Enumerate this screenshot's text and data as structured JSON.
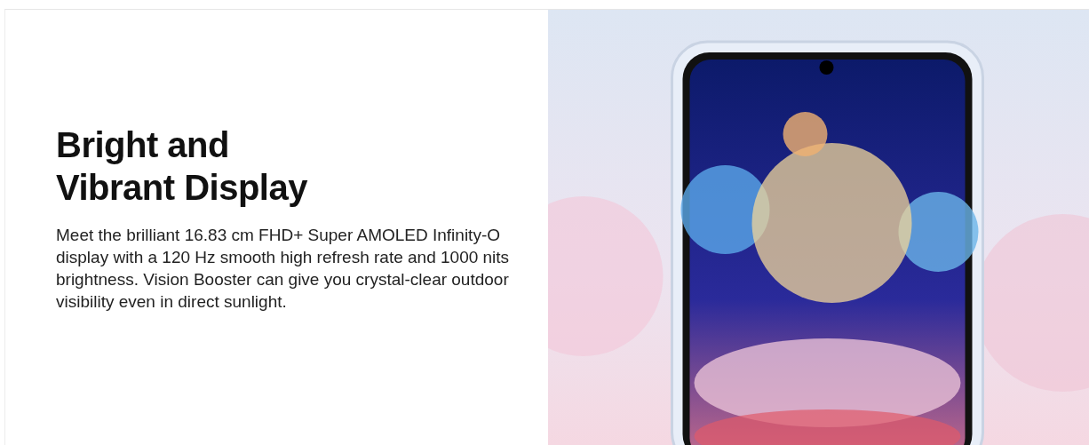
{
  "feature": {
    "title_lines": [
      "Bright and",
      "Vibrant Display"
    ],
    "description": "Meet the brilliant 16.83 cm FHD+ Super AMOLED Infinity-O display with a 120 Hz smooth high refresh rate and 1000 nits brightness. Vision Booster can give you crystal-clear outdoor visibility even in direct sunlight."
  }
}
